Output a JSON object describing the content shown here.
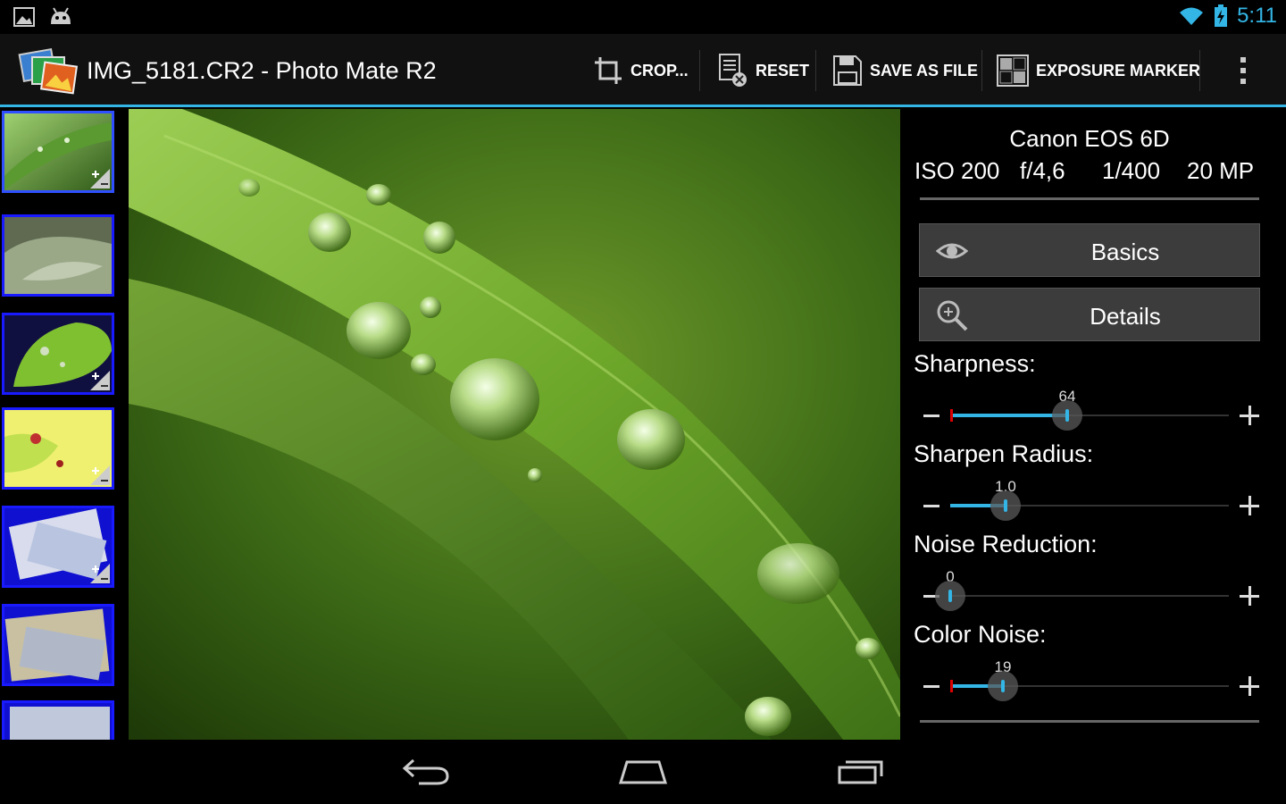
{
  "status_bar": {
    "time": "5:11",
    "icons": [
      "gallery-icon",
      "android-icon",
      "wifi-icon",
      "battery-charging-icon"
    ]
  },
  "action_bar": {
    "title": "IMG_5181.CR2 - Photo Mate R2",
    "actions": {
      "crop": "CROP...",
      "reset": "RESET",
      "save": "SAVE AS FILE",
      "exposure": "EXPOSURE MARKER"
    }
  },
  "thumbnails": {
    "count": 7,
    "selected_index": 0
  },
  "panel": {
    "camera": "Canon EOS 6D",
    "exif": {
      "iso": "ISO 200",
      "aperture": "f/4,6",
      "shutter": "1/400",
      "megapixels": "20 MP"
    },
    "buttons": {
      "basics": "Basics",
      "details": "Details"
    },
    "sliders": [
      {
        "label": "Sharpness:",
        "value": "64",
        "fraction": 0.42
      },
      {
        "label": "Sharpen Radius:",
        "value": "1.0",
        "fraction": 0.2
      },
      {
        "label": "Noise Reduction:",
        "value": "0",
        "fraction": 0.0
      },
      {
        "label": "Color Noise:",
        "value": "19",
        "fraction": 0.19
      }
    ]
  },
  "colors": {
    "accent": "#33b5e5",
    "button_bg": "#3c3c3c",
    "thumb_border": "#1a1aff"
  }
}
